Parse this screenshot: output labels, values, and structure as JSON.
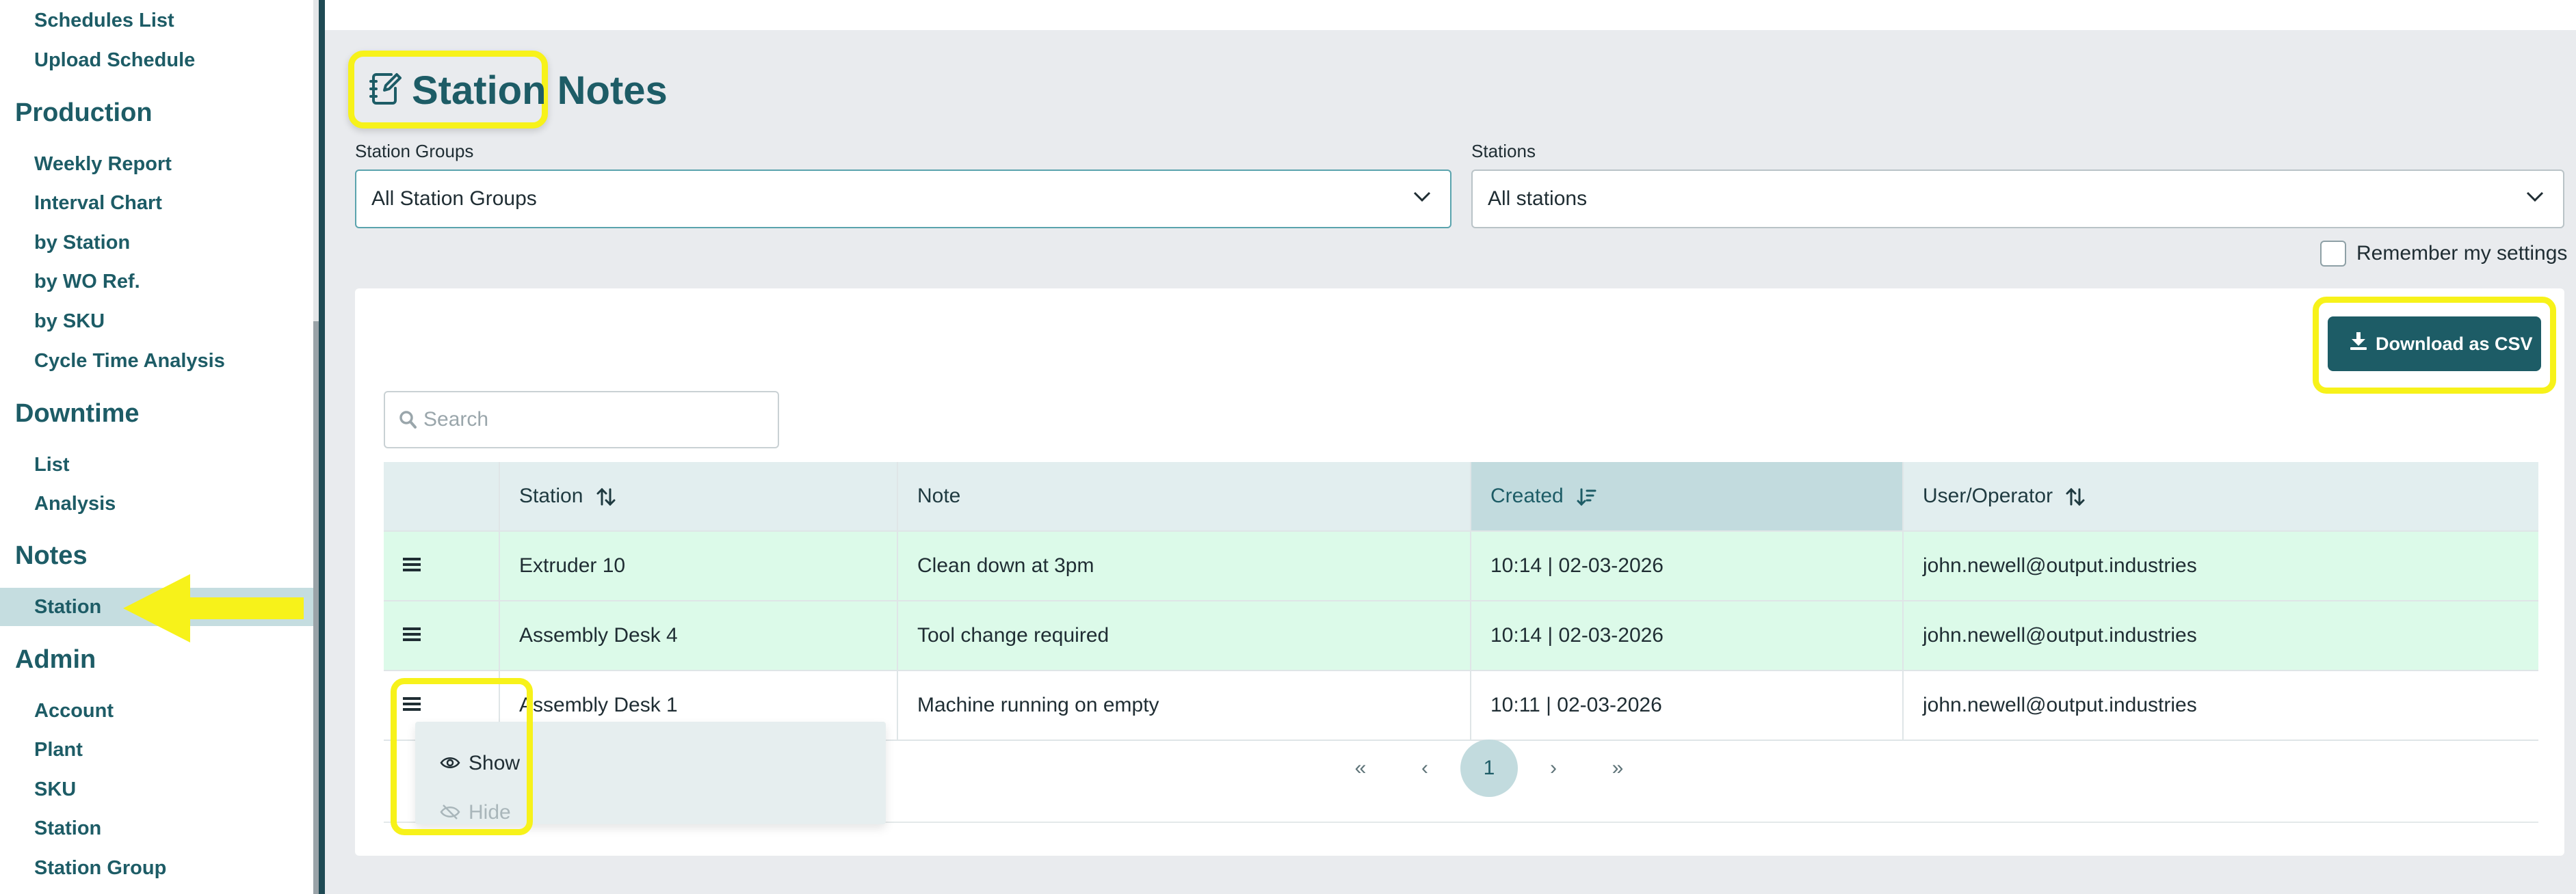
{
  "sidebar": {
    "production_items_top": [
      "Schedules List",
      "Upload Schedule"
    ],
    "sections": [
      {
        "title": "Production",
        "items": [
          "Weekly Report",
          "Interval Chart",
          "by Station",
          "by WO Ref.",
          "by SKU",
          "Cycle Time Analysis"
        ]
      },
      {
        "title": "Downtime",
        "items": [
          "List",
          "Analysis"
        ]
      },
      {
        "title": "Notes",
        "items": [
          "Station"
        ]
      },
      {
        "title": "Admin",
        "items": [
          "Account",
          "Plant",
          "SKU",
          "Station",
          "Station Group"
        ]
      }
    ],
    "active_item": "Station"
  },
  "page": {
    "title": "Station Notes",
    "title_icon": "notebook-pen-icon"
  },
  "filters": {
    "station_groups_label": "Station Groups",
    "station_groups_value": "All Station Groups",
    "stations_label": "Stations",
    "stations_value": "All stations",
    "remember_label": "Remember my settings",
    "remember_checked": false
  },
  "toolbar": {
    "download_csv_label": "Download as CSV"
  },
  "search": {
    "placeholder": "Search",
    "value": ""
  },
  "table": {
    "columns": [
      "",
      "Station",
      "Note",
      "Created",
      "User/Operator"
    ],
    "sorted_column": "Created",
    "rows": [
      {
        "station": "Extruder 10",
        "note": "Clean down at 3pm",
        "created": "10:14 | 02-03-2026",
        "user": "john.newell@output.industries",
        "state": "visible"
      },
      {
        "station": "Assembly Desk 4",
        "note": "Tool change required",
        "created": "10:14 | 02-03-2026",
        "user": "john.newell@output.industries",
        "state": "visible"
      },
      {
        "station": "Assembly Desk 1",
        "note": "Machine running on empty",
        "created": "10:11 | 02-03-2026",
        "user": "john.newell@output.industries",
        "state": "default"
      }
    ]
  },
  "row_menu": {
    "show_label": "Show",
    "hide_label": "Hide"
  },
  "pager": {
    "first": "«",
    "prev": "‹",
    "current": "1",
    "next": "›",
    "last": "»"
  },
  "colors": {
    "brand": "#1d5c66",
    "highlight": "#f7f21a",
    "row_visible": "#dcfae9",
    "header_bg": "#e2eeef"
  }
}
